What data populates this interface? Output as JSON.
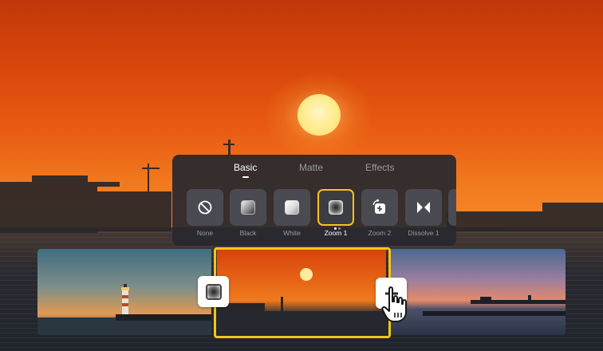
{
  "panel": {
    "tabs": [
      {
        "label": "Basic",
        "active": true
      },
      {
        "label": "Matte",
        "active": false
      },
      {
        "label": "Effects",
        "active": false
      }
    ],
    "transitions": [
      {
        "label": "None",
        "icon": "none-icon"
      },
      {
        "label": "Black",
        "icon": "black-fade-icon"
      },
      {
        "label": "White",
        "icon": "white-fade-icon"
      },
      {
        "label": "Zoom 1",
        "icon": "zoom-icon",
        "selected": true
      },
      {
        "label": "Zoom 2",
        "icon": "zoom-rotate-icon"
      },
      {
        "label": "Dissolve 1",
        "icon": "dissolve-icon"
      }
    ]
  },
  "timeline": {
    "clips": [
      {
        "name": "lighthouse-clip"
      },
      {
        "name": "sunset-clip",
        "selected": true
      },
      {
        "name": "pier-dusk-clip"
      }
    ],
    "transition_buttons": [
      {
        "icon": "transition-applied-icon"
      },
      {
        "icon": "add-transition-icon"
      }
    ]
  },
  "colors": {
    "accent": "#f5c518",
    "panel_bg": "#28282e",
    "tile_bg": "#4a4a52"
  }
}
